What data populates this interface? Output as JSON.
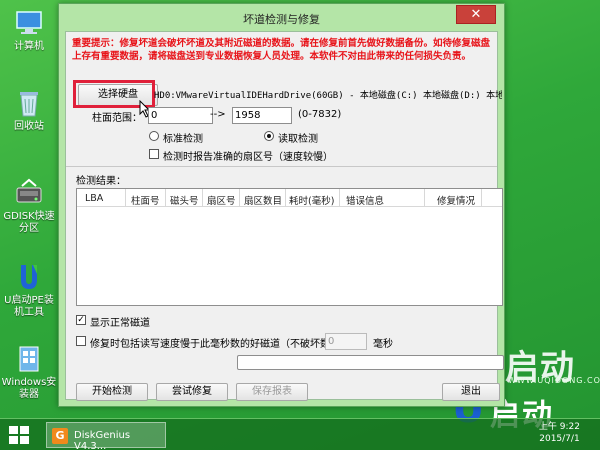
{
  "desktop": {
    "icons": [
      {
        "label": "计算机"
      },
      {
        "label": "回收站"
      },
      {
        "label": "GDISK快速分区"
      },
      {
        "label": "U启动PE装机工具"
      },
      {
        "label": "Windows安装器"
      }
    ],
    "brand_big": "启动",
    "brand_url": "WWW.UQIDONG.COM",
    "brand_logo": "启动"
  },
  "dialog": {
    "title": "坏道检测与修复",
    "close_label": "✕",
    "warning": "重要提示：修复坏道会破坏坏道及其附近磁道的数据。请在修复前首先做好数据备份。如待修复磁盘上存有重要数据，请将磁盘送到专业数据恢复人员处理。本软件不对由此带来的任何损失负责。",
    "select_disk_label": "选择硬盘",
    "disk_info": "HD0:VMwareVirtualIDEHardDrive(60GB) - 本地磁盘(C:) 本地磁盘(D:) 本地",
    "cylinder_label": "柱面范围：",
    "cylinder_from": "0",
    "arrow": "-->",
    "cylinder_to": "1958",
    "cylinder_range": "(0-7832)",
    "mode_standard": "标准检测",
    "mode_read": "读取检测",
    "mode_selected": "read",
    "report_sector_label": "检测时报告准确的扇区号（速度较慢）",
    "results_label": "检测结果：",
    "columns": [
      "LBA",
      "柱面号",
      "磁头号",
      "扇区号",
      "扇区数目",
      "耗时(毫秒)",
      "错误信息",
      "修复情况"
    ],
    "rows": [],
    "show_normal_label": "显示正常磁道",
    "show_normal_checked": true,
    "repair_slow_label": "修复时包括读写速度慢于此毫秒数的好磁道（不破坏数据）：",
    "repair_slow_checked": false,
    "ms_value": "0",
    "ms_unit": "毫秒",
    "progress": 0,
    "buttons": {
      "start": "开始检测",
      "try_repair": "尝试修复",
      "save_report": "保存报表",
      "exit": "退出"
    }
  },
  "taskbar": {
    "item_label": "DiskGenius V4.3...",
    "time": "上午 9:22",
    "date": "2015/7/1"
  },
  "colors": {
    "desktop_green": "#2fa83a",
    "dialog_frame": "#b4e5a7",
    "warning_red": "#e8141a",
    "highlight_red": "#e0203a"
  }
}
